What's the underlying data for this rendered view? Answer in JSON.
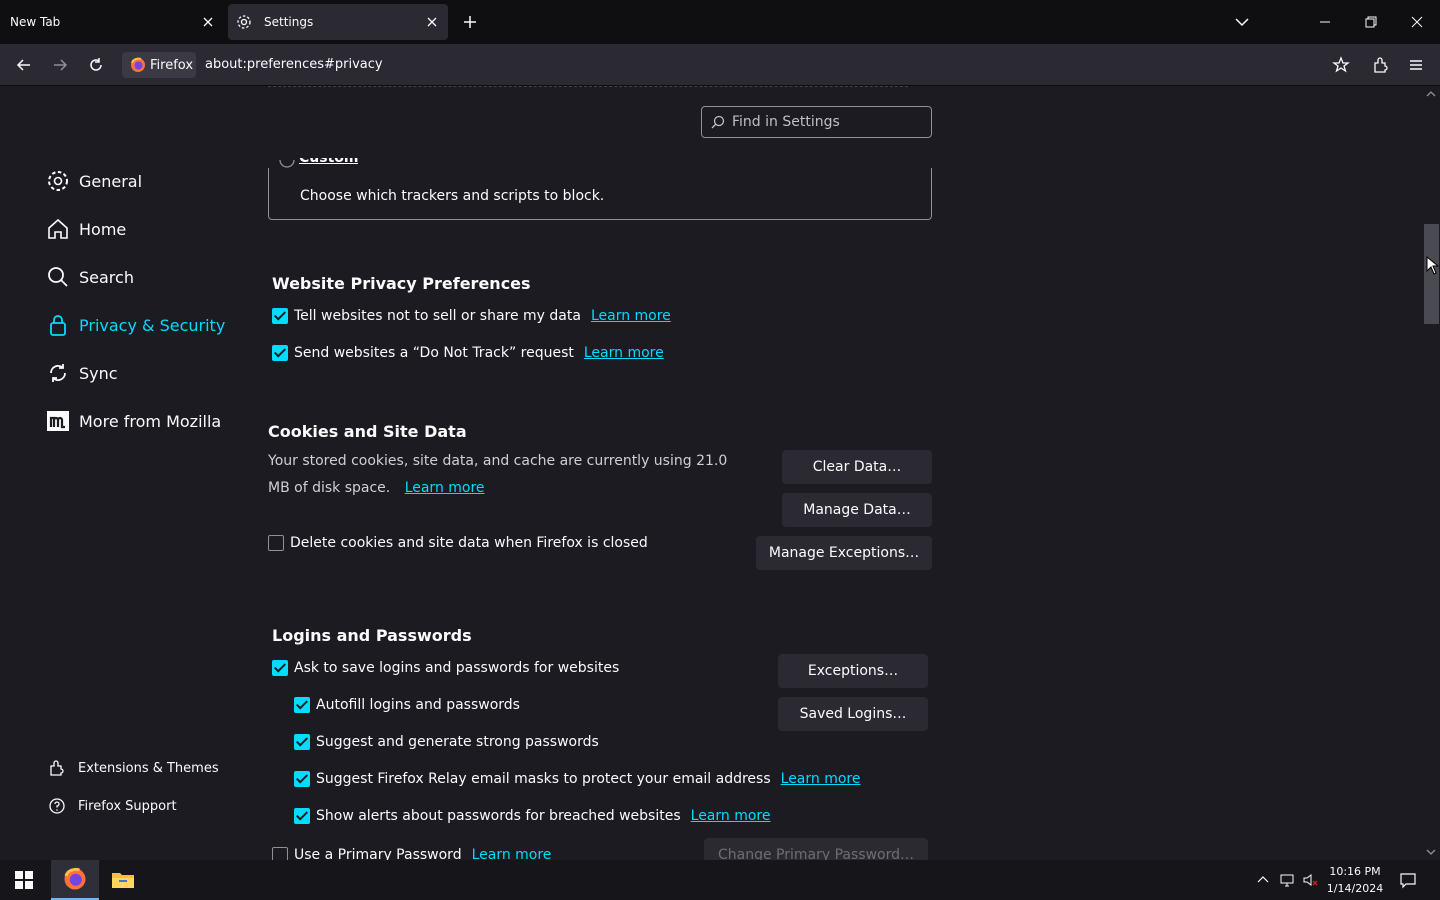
{
  "tabs": [
    {
      "title": "New Tab"
    },
    {
      "title": "Settings"
    }
  ],
  "urlbar": {
    "identity_label": "Firefox",
    "url": "about:preferences#privacy"
  },
  "search": {
    "placeholder": "Find in Settings"
  },
  "sidebar": {
    "items": [
      {
        "label": "General",
        "icon": "gear-icon"
      },
      {
        "label": "Home",
        "icon": "home-icon"
      },
      {
        "label": "Search",
        "icon": "search-icon"
      },
      {
        "label": "Privacy & Security",
        "icon": "lock-icon"
      },
      {
        "label": "Sync",
        "icon": "sync-icon"
      },
      {
        "label": "More from Mozilla",
        "icon": "mozilla-icon"
      }
    ],
    "footer": [
      {
        "label": "Extensions & Themes",
        "icon": "puzzle-icon"
      },
      {
        "label": "Firefox Support",
        "icon": "help-icon"
      }
    ]
  },
  "tracking": {
    "custom_label": "Custom",
    "custom_desc": "Choose which trackers and scripts to block."
  },
  "privacy_prefs": {
    "title": "Website Privacy Preferences",
    "items": [
      {
        "label": "Tell websites not to sell or share my data",
        "link": "Learn more",
        "checked": true
      },
      {
        "label": "Send websites a “Do Not Track” request",
        "link": "Learn more",
        "checked": true
      }
    ]
  },
  "cookies": {
    "title": "Cookies and Site Data",
    "desc": "Your stored cookies, site data, and cache are currently using 21.0 MB of disk space.",
    "link": "Learn more",
    "delete_label": "Delete cookies and site data when Firefox is closed",
    "delete_checked": false,
    "buttons": {
      "clear": "Clear Data…",
      "manage": "Manage Data…",
      "exceptions": "Manage Exceptions…"
    }
  },
  "logins": {
    "title": "Logins and Passwords",
    "items": [
      {
        "label": "Ask to save logins and passwords for websites",
        "checked": true
      },
      {
        "label": "Autofill logins and passwords",
        "checked": true
      },
      {
        "label": "Suggest and generate strong passwords",
        "checked": true
      },
      {
        "label": "Suggest Firefox Relay email masks to protect your email address",
        "link": "Learn more",
        "checked": true
      },
      {
        "label": "Show alerts about passwords for breached websites",
        "link": "Learn more",
        "checked": true
      },
      {
        "label": "Use a Primary Password",
        "link": "Learn more",
        "checked": false
      }
    ],
    "buttons": {
      "exceptions": "Exceptions…",
      "saved": "Saved Logins…",
      "change_primary": "Change Primary Password…"
    }
  },
  "taskbar": {
    "time": "10:16 PM",
    "date": "1/14/2024"
  },
  "colors": {
    "accent": "#00ddff",
    "background": "#1c1b22",
    "surface": "#2b2a33"
  }
}
